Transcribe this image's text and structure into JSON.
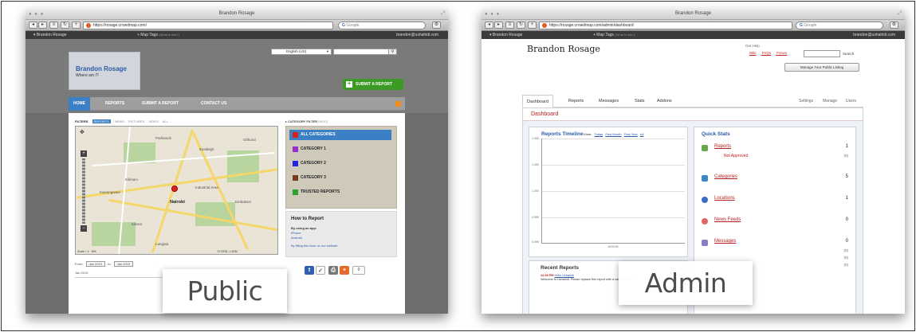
{
  "labels": {
    "public": "Public",
    "admin": "Admin"
  },
  "public_browser": {
    "title": "Brandon Rosage",
    "url": "https://rosage.crowdmap.com/",
    "search_placeholder": "Google",
    "mapbar_user": "Brandon Rosage",
    "mapbar_middle": "+ Map Tags",
    "mapbar_middle_small": "(What is this?)",
    "mapbar_email": "brandon@ushahidi.com"
  },
  "public_page": {
    "site_name": "Brandon Rosage",
    "tagline": "Where am I?",
    "language": "English (US)",
    "submit_button": "SUBMIT A REPORT",
    "nav": [
      "HOME",
      "REPORTS",
      "SUBMIT A REPORT",
      "CONTACT US"
    ],
    "filters_label": "FILTERS",
    "filters": [
      "REPORTS",
      "NEWS",
      "PICTURES",
      "VIDEO",
      "ALL"
    ],
    "category_filter": "CATEGORY FILTER",
    "category_filter_hide": "[HIDE]",
    "categories": [
      {
        "label": "ALL CATEGORIES",
        "color": "#d42020"
      },
      {
        "label": "CATEGORY 1",
        "color": "#9a2fc8"
      },
      {
        "label": "CATEGORY 2",
        "color": "#2323e0"
      },
      {
        "label": "CATEGORY 3",
        "color": "#7a3a1a"
      },
      {
        "label": "TRUSTED REPORTS",
        "color": "#2ea02e"
      }
    ],
    "how_to": {
      "title": "How to Report",
      "using_app": "By using an app:",
      "iphone": "iPhone",
      "android": "Android",
      "form": "By filling this form on our website."
    },
    "map_towns": [
      "Nairobi",
      "Eastleigh",
      "Parklands",
      "Githurai",
      "Embakasi",
      "Kawangware",
      "Kilimani",
      "Kibera",
      "Industrial Area",
      "Langata"
    ],
    "map_scale": "Scale = 1 : 30K",
    "map_coords": "37.0235,-1.3034",
    "timeline": {
      "from_label": "From:",
      "to_label": "to:",
      "from": "Jan 2010",
      "to": "Jan 2010",
      "axis": "Jan 2010"
    },
    "share_count": "0"
  },
  "admin_browser": {
    "title": "Brandon Rosage",
    "url": "https://rosage.crowdmap.com/admin/dashboard",
    "search_placeholder": "Google",
    "mapbar_user": "Brandon Rosage",
    "mapbar_middle": "+ Map Tags",
    "mapbar_middle_small": "(What is this?)",
    "mapbar_email": "brandon@ushahidi.com"
  },
  "admin_page": {
    "site_name": "Brandon Rosage",
    "get_help": "Get Help",
    "help_links": [
      "Wiki",
      "FAQs",
      "Forum"
    ],
    "search_button": "Search",
    "manage_button": "Manage Your Public Listing",
    "tabs": [
      "Dashboard",
      "Reports",
      "Messages",
      "Stats",
      "Addons"
    ],
    "right_tabs": [
      "Settings",
      "Manage",
      "Users"
    ],
    "dashboard_heading": "Dashboard",
    "timeline_title": "Reports Timeline",
    "timeline_view": "View:",
    "timeline_ranges": [
      "Today",
      "Past Month",
      "Past Year",
      "All"
    ],
    "timeline_yticks": [
      "1.000",
      "1.000",
      "1.000",
      "0.999",
      "0.999"
    ],
    "timeline_xtick": "16:00:00",
    "recent_title": "Recent Reports",
    "recent_time": "12:00 PM",
    "recent_link": "Hello Ushahidi",
    "recent_text": "Welcome to Ushahidi. Please replace this report with a valid incident",
    "quick_stats_title": "Quick Stats",
    "quick_stats": [
      {
        "label": "Reports",
        "value": "1",
        "icon_color": "#6aa84f"
      },
      {
        "label": "Categories",
        "value": "5",
        "icon_color": "#3d85c6"
      },
      {
        "label": "Locations",
        "value": "1",
        "icon_color": "#3d6dc6"
      },
      {
        "label": "News Feeds",
        "value": "0",
        "icon_color": "#e06666"
      },
      {
        "label": "Messages",
        "value": "0",
        "icon_color": "#8e7cc3"
      }
    ],
    "not_approved_label": "Not Approved",
    "not_approved_value": "(0)",
    "message_counts": [
      "(0)",
      "(0)",
      "(0)"
    ]
  }
}
